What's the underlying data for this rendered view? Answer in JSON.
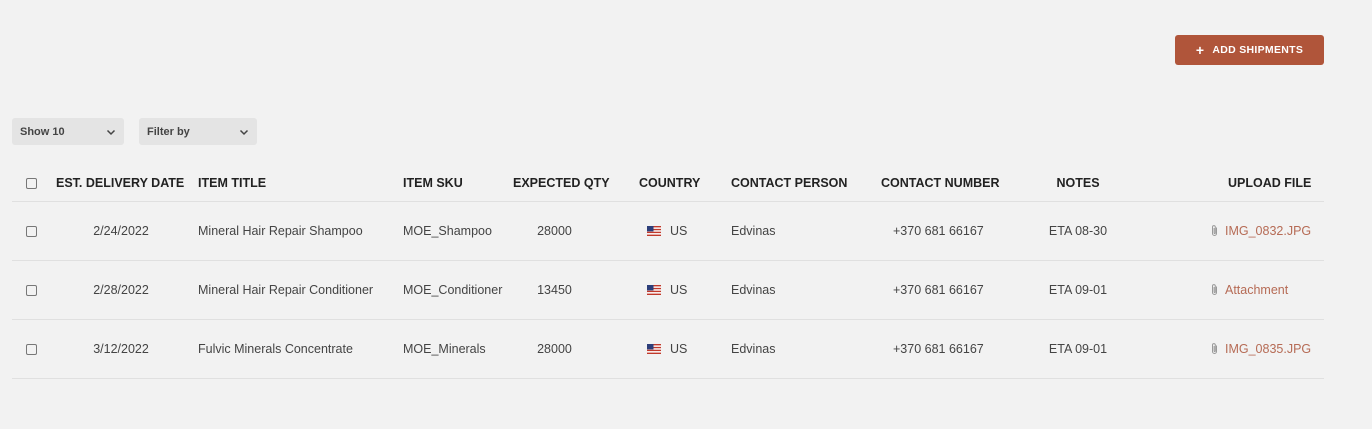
{
  "toolbar": {
    "add_button_label": "ADD SHIPMENTS",
    "add_button_color": "#b0553a",
    "show_dropdown": "Show 10",
    "filter_dropdown": "Filter by"
  },
  "table": {
    "columns": {
      "date": "EST. DELIVERY DATE",
      "title": "ITEM TITLE",
      "sku": "ITEM SKU",
      "qty": "EXPECTED QTY",
      "country": "COUNTRY",
      "contact": "CONTACT PERSON",
      "number": "CONTACT NUMBER",
      "notes": "NOTES",
      "upload": "UPLOAD FILE"
    },
    "rows": [
      {
        "date": "2/24/2022",
        "title": "Mineral Hair Repair Shampoo",
        "sku": "MOE_Shampoo",
        "qty": "28000",
        "country": "US",
        "contact": "Edvinas",
        "number": "+370 681 66167",
        "notes": "ETA 08-30",
        "file": "IMG_0832.JPG"
      },
      {
        "date": "2/28/2022",
        "title": "Mineral Hair Repair Conditioner",
        "sku": "MOE_Conditioner",
        "qty": "13450",
        "country": "US",
        "contact": "Edvinas",
        "number": "+370 681 66167",
        "notes": "ETA 09-01",
        "file": "Attachment"
      },
      {
        "date": "3/12/2022",
        "title": "Fulvic Minerals Concentrate",
        "sku": "MOE_Minerals",
        "qty": "28000",
        "country": "US",
        "contact": "Edvinas",
        "number": "+370 681 66167",
        "notes": "ETA 09-01",
        "file": "IMG_0835.JPG"
      }
    ]
  },
  "icons": {
    "plus": "plus-icon",
    "chevron": "chevron-down-icon",
    "flag": "us-flag-icon",
    "attachment": "paperclip-icon"
  },
  "colors": {
    "link": "#b66b55",
    "background": "#f2f2f2"
  }
}
